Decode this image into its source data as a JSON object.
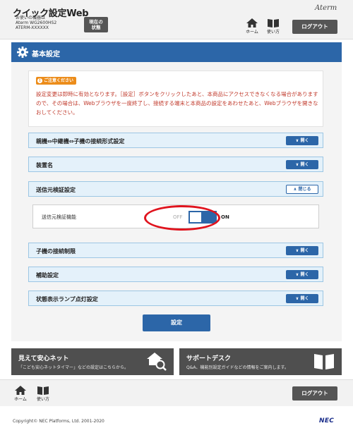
{
  "header": {
    "app_title": "クイック設定Web",
    "device_caption": "お使いの機器は",
    "device_model": "Aterm WG2600HS2",
    "device_ssid": "ATERM-XXXXXX",
    "status_button": "現在の\n状態",
    "brand": "Aterm",
    "home_label": "ホーム",
    "help_label": "使い方",
    "logout_label": "ログアウト"
  },
  "section": {
    "title": "基本設定"
  },
  "notice": {
    "badge": "ご注意ください",
    "text": "設定変更は即時に有効となります。［設定］ボタンをクリックしたあと、本商品にアクセスできなくなる場合がありますので、その場合は、Webブラウザを一度終了し、接続する端末と本商品の設定をあわせたあと、Webブラウザを開きなおしてください。"
  },
  "accordions": [
    {
      "label": "親機⇔中継機⇔子機の接続形式設定",
      "button": "開く"
    },
    {
      "label": "装置名",
      "button": "開く"
    },
    {
      "label": "送信元検証設定",
      "button": "閉じる"
    },
    {
      "label": "子機の接続制限",
      "button": "開く"
    },
    {
      "label": "補助設定",
      "button": "開く"
    },
    {
      "label": "状態表示ランプ点灯設定",
      "button": "開く"
    }
  ],
  "source_verify": {
    "field_label": "送信元検証機能",
    "off_label": "OFF",
    "on_label": "ON",
    "state": "ON"
  },
  "submit_label": "設定",
  "banners": {
    "left_title": "見えて安心ネット",
    "left_sub": "「こども安心ネットタイマー」などの設定はこちらから。",
    "right_title": "サポートデスク",
    "right_sub": "Q&A、機能別設定ガイドなどの情報をご案内します。"
  },
  "footer": {
    "home_label": "ホーム",
    "help_label": "使い方",
    "logout_label": "ログアウト",
    "copyright": "Copyright© NEC Platforms, Ltd. 2001-2020",
    "nec": "NEC"
  },
  "colors": {
    "primary": "#2c66a8",
    "notice_text": "#c0392b",
    "notice_badge": "#ec8c1a",
    "highlight": "#e0141e"
  }
}
